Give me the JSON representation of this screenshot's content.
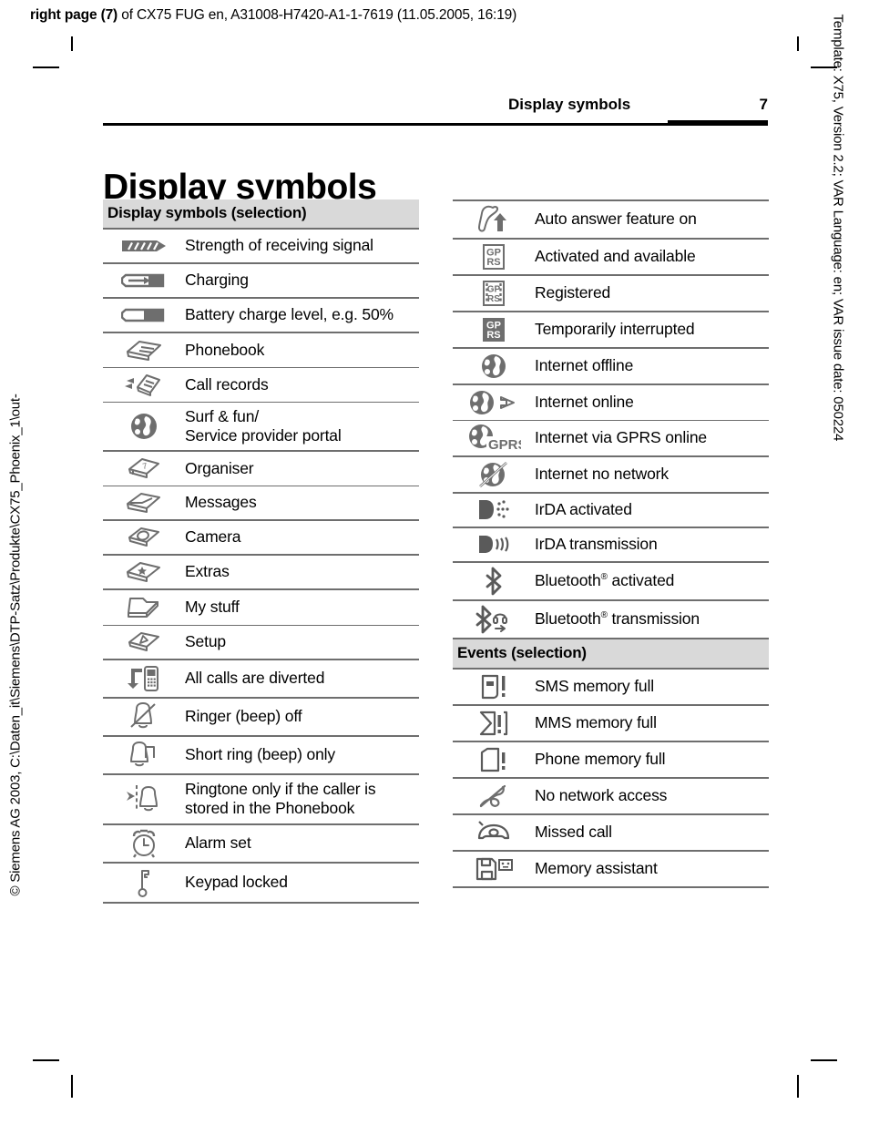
{
  "doc_header": {
    "bold_part": "right page (7)",
    "rest": " of CX75 FUG en, A31008-H7420-A1-1-7619 (11.05.2005, 16:19)"
  },
  "side_text": {
    "left": "© Siemens AG 2003, C:\\Daten_it\\Siemens\\DTP-Satz\\Produkte\\CX75_Phoenix_1\\out-",
    "right": "Template: X75, Version 2.2; VAR Language: en; VAR issue date: 050224"
  },
  "running_head": {
    "title": "Display symbols",
    "page_number": "7"
  },
  "page_title": "Display symbols",
  "colors": {
    "section_header_bg": "#d9d9d9",
    "rule": "#6e6e6e",
    "icon_gray": "#6e6e6e",
    "icon_dark": "#5a5a5a",
    "text": "#000000"
  },
  "left_column": {
    "section_title": "Display symbols (selection)",
    "rows": [
      {
        "icon": "signal-strength-icon",
        "label": "Strength of receiving signal"
      },
      {
        "icon": "battery-charging-icon",
        "label": "Charging"
      },
      {
        "icon": "battery-level-icon",
        "label": "Battery charge level, e.g. 50%"
      },
      {
        "icon": "phonebook-icon",
        "label": "Phonebook"
      },
      {
        "icon": "call-records-icon",
        "label": "Call records"
      },
      {
        "icon": "surf-and-fun-icon",
        "label": "Surf & fun/",
        "label_line2": "Service provider portal"
      },
      {
        "icon": "organiser-icon",
        "label": "Organiser"
      },
      {
        "icon": "messages-icon",
        "label": "Messages"
      },
      {
        "icon": "camera-icon",
        "label": "Camera"
      },
      {
        "icon": "extras-icon",
        "label": "Extras"
      },
      {
        "icon": "my-stuff-icon",
        "label": "My stuff"
      },
      {
        "icon": "setup-icon",
        "label": "Setup"
      },
      {
        "icon": "call-divert-icon",
        "label": "All calls are diverted"
      },
      {
        "icon": "ringer-off-icon",
        "label": "Ringer (beep) off"
      },
      {
        "icon": "short-ring-icon",
        "label": "Short ring (beep) only"
      },
      {
        "icon": "ringtone-phonebook-icon",
        "label": "Ringtone only if the caller is",
        "label_line2": "stored in the Phonebook"
      },
      {
        "icon": "alarm-clock-icon",
        "label": "Alarm set"
      },
      {
        "icon": "keypad-lock-icon",
        "label": "Keypad locked"
      }
    ]
  },
  "right_column": {
    "rows": [
      {
        "icon": "auto-answer-icon",
        "label": "Auto answer feature on"
      },
      {
        "icon": "gprs-available-icon",
        "label": "Activated and available"
      },
      {
        "icon": "gprs-registered-icon",
        "label": "Registered"
      },
      {
        "icon": "gprs-interrupted-icon",
        "label": "Temporarily interrupted"
      },
      {
        "icon": "internet-offline-icon",
        "label": "Internet offline"
      },
      {
        "icon": "internet-online-icon",
        "label": "Internet online"
      },
      {
        "icon": "internet-gprs-icon",
        "label": "Internet via GPRS online"
      },
      {
        "icon": "internet-no-network-icon",
        "label": "Internet no network"
      },
      {
        "icon": "irda-activated-icon",
        "label": "IrDA activated"
      },
      {
        "icon": "irda-transmission-icon",
        "label": "IrDA transmission"
      },
      {
        "icon": "bluetooth-activated-icon",
        "label": "Bluetooth",
        "label_sup": "®",
        "label_tail": " activated"
      },
      {
        "icon": "bluetooth-transmission-icon",
        "label": "Bluetooth",
        "label_sup": "®",
        "label_tail": " transmission"
      }
    ],
    "events_section_title": "Events (selection)",
    "events_rows": [
      {
        "icon": "sms-memory-full-icon",
        "label": "SMS memory full"
      },
      {
        "icon": "mms-memory-full-icon",
        "label": "MMS memory full"
      },
      {
        "icon": "phone-memory-full-icon",
        "label": "Phone memory full"
      },
      {
        "icon": "no-network-access-icon",
        "label": "No network access"
      },
      {
        "icon": "missed-call-icon",
        "label": "Missed call"
      },
      {
        "icon": "memory-assistant-icon",
        "label": "Memory assistant"
      }
    ]
  }
}
